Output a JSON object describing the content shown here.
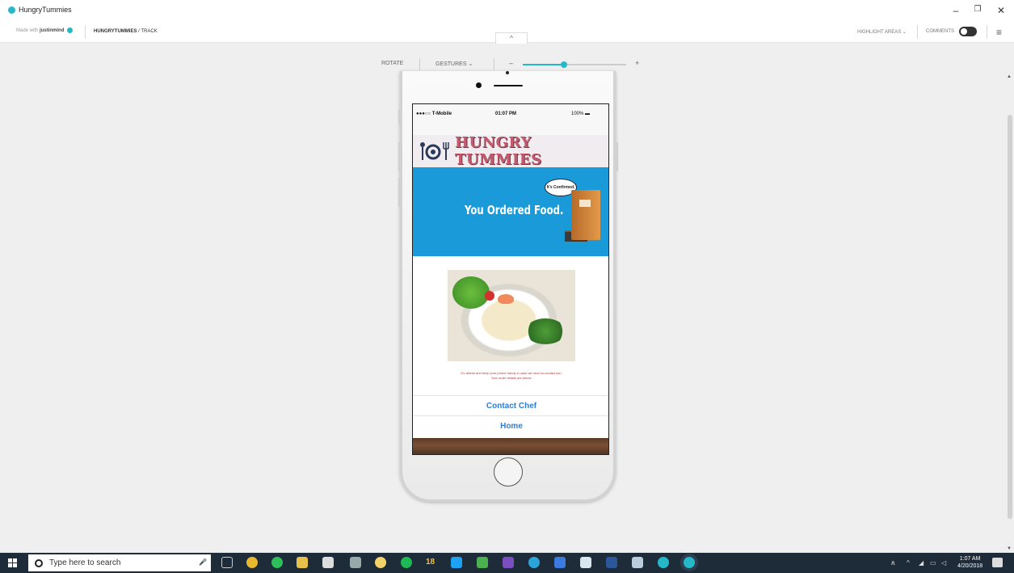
{
  "window": {
    "title": "HungryTummies",
    "controls": {
      "minimize": "–",
      "restore": "❐",
      "close": "✕"
    }
  },
  "toolbar": {
    "made_with_prefix": "Made with",
    "made_with_brand": "justinmind",
    "breadcrumb_project": "HUNGRYTUMMIES",
    "breadcrumb_sep": " / ",
    "breadcrumb_page": "TRACK",
    "highlight_label": "HIGHLIGHT AREAS",
    "comments_label": "COMMENTS",
    "collapse_label": "^"
  },
  "controls": {
    "rotate_label": "ROTATE",
    "gestures_label": "GESTURES",
    "zoom_minus": "–",
    "zoom_plus": "+",
    "zoom_level": 0.4
  },
  "phone": {
    "status": {
      "carrier": "●●●○○ T-Mobile",
      "time": "01:07 PM",
      "battery": "100%"
    },
    "logo_text": "HUNGRY TUMMIES",
    "banner": {
      "headline": "You Ordered Food.",
      "bubble": "It's Confirmed."
    },
    "message_line1": "Go ahead and keep your phone handy in case we need to contact you.",
    "message_line2": "Your order details are below.",
    "buttons": {
      "contact": "Contact Chef",
      "home": "Home"
    }
  },
  "taskbar": {
    "search_placeholder": "Type here to search",
    "badge_count": "18",
    "clock_time": "1:07 AM",
    "clock_date": "4/20/2018"
  },
  "colors": {
    "accent": "#25b8c9",
    "banner": "#1a9ad8",
    "link": "#2e7fd3",
    "message": "#c0393b",
    "taskbar": "#1e2b38"
  }
}
